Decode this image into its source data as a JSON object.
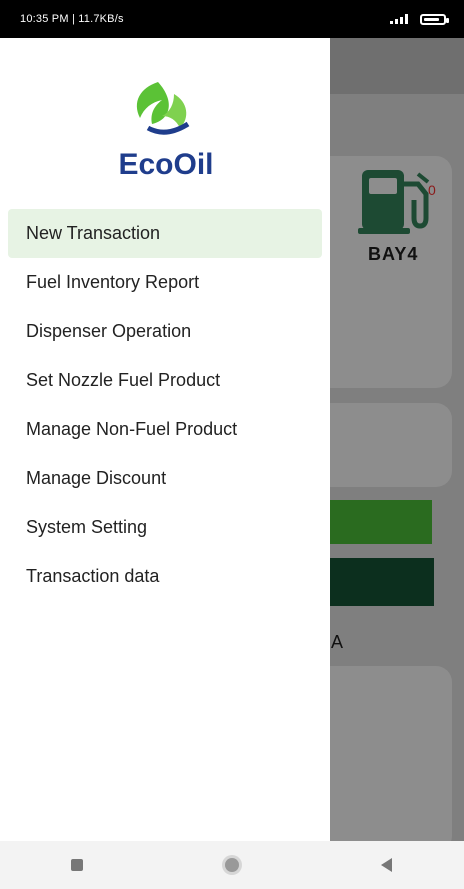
{
  "status_bar": {
    "left_text": "10:35 PM | 11.7KB/s"
  },
  "background": {
    "bay_label": "BAY4",
    "pump_count": "0",
    "partial_letter": "A"
  },
  "drawer": {
    "brand": "EcoOil",
    "menu": [
      {
        "label": "New Transaction",
        "active": true
      },
      {
        "label": "Fuel Inventory Report"
      },
      {
        "label": "Dispenser Operation"
      },
      {
        "label": "Set Nozzle Fuel Product"
      },
      {
        "label": "Manage Non-Fuel Product"
      },
      {
        "label": "Manage Discount"
      },
      {
        "label": "System Setting"
      },
      {
        "label": "Transaction data"
      }
    ]
  },
  "colors": {
    "brand_blue": "#1f3d8c",
    "brand_green": "#5bc236",
    "active_bg": "#e7f3e4",
    "dark_green": "#0c2f1e"
  },
  "icons": [
    "signal-icon",
    "battery-icon",
    "fuel-pump-icon",
    "recents-icon",
    "home-icon",
    "back-icon"
  ]
}
